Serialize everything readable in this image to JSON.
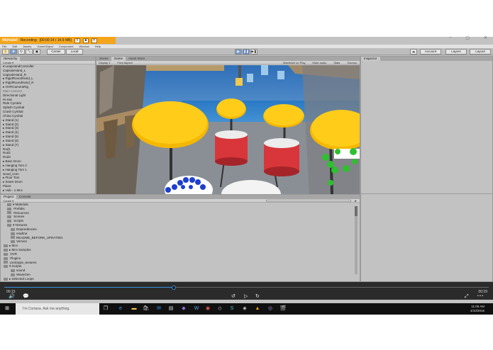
{
  "recorder": {
    "logo": "movavi",
    "status": "Recording",
    "timecode": "[00:00:14 / 14.9 MB]",
    "ctrl_pause": "II",
    "ctrl_stop": "■",
    "ctrl_cancel": "✕"
  },
  "window_controls": {
    "minimize": "–",
    "maximize": "▢",
    "close": "✕"
  },
  "menu": [
    "File",
    "Edit",
    "Assets",
    "GameObject",
    "Component",
    "Window",
    "Help"
  ],
  "toolbar": {
    "pivot": "Center",
    "space": "Local",
    "account": "Account",
    "layers": "Layers",
    "layout": "Layout"
  },
  "hierarchy": {
    "tab": "Hierarchy",
    "create": "Create ▾",
    "items": [
      {
        "label": "▾ LeapHandController",
        "gray": false
      },
      {
        "label": "   CapsuleHand_L",
        "gray": false
      },
      {
        "label": "   CapsuleHand_R",
        "gray": false
      },
      {
        "label": "  ▸ RigidRoundHand_L",
        "gray": false
      },
      {
        "label": "  ▸ RigidRoundHand_R",
        "gray": false
      },
      {
        "label": "▸ OVRCameraRig",
        "gray": false
      },
      {
        "label": "  Main Camera",
        "gray": true
      },
      {
        "label": "  Directional Light",
        "gray": false
      },
      {
        "label": "  Hi-Hat",
        "gray": false
      },
      {
        "label": "  Ride Cymbal",
        "gray": false
      },
      {
        "label": "  Splash Cymbal",
        "gray": false
      },
      {
        "label": "  Crash Cymbal",
        "gray": false
      },
      {
        "label": "  China Cymbal",
        "gray": false
      },
      {
        "label": "▸ Stand (1)",
        "gray": false
      },
      {
        "label": "▸ Stand (2)",
        "gray": false
      },
      {
        "label": "▸ Stand (3)",
        "gray": false
      },
      {
        "label": "▸ Stand (4)",
        "gray": false
      },
      {
        "label": "▸ Stand (5)",
        "gray": false
      },
      {
        "label": "▸ Stand (6)",
        "gray": false
      },
      {
        "label": "▸ Stand (7)",
        "gray": false
      },
      {
        "label": "  Rod1",
        "gray": false
      },
      {
        "label": "  Rod2",
        "gray": false
      },
      {
        "label": "  Rod3",
        "gray": false
      },
      {
        "label": "▸ Bass Drum",
        "gray": false
      },
      {
        "label": "▸ Hanging Tom 2",
        "gray": false
      },
      {
        "label": "▸ Hanging Tom 1",
        "gray": false
      },
      {
        "label": "  wood_scen",
        "gray": false
      },
      {
        "label": "▸ Floor Tom",
        "gray": false
      },
      {
        "label": "▸ Snare Drum",
        "gray": false
      },
      {
        "label": "  Plane",
        "gray": false
      },
      {
        "label": "▸ Hub - 1 Mcs",
        "gray": false
      }
    ]
  },
  "scene_tabs": {
    "scene": "Scene",
    "game": "Game",
    "store": "Asset Store",
    "display": "Display 1",
    "aspect": "Free Aspect",
    "maximize": "Maximize on Play",
    "mute": "Mute audio",
    "stats": "Stats",
    "gizmos": "Gizmos"
  },
  "inspector": {
    "tab": "Inspector"
  },
  "project": {
    "tab_project": "Project",
    "tab_console": "Console",
    "create": "Create ▾",
    "items": [
      {
        "label": "▾ Materials",
        "indent": 1
      },
      {
        "label": "  Prefabs",
        "indent": 1
      },
      {
        "label": "  Resources",
        "indent": 1
      },
      {
        "label": "  Scenes",
        "indent": 1
      },
      {
        "label": "  Scripts",
        "indent": 1
      },
      {
        "label": "▾ Textures",
        "indent": 1
      },
      {
        "label": "Dependencies",
        "indent": 2
      },
      {
        "label": "readme",
        "indent": 2
      },
      {
        "label": "README_BEFORE_UPDATING",
        "indent": 2
      },
      {
        "label": "Version",
        "indent": 2
      },
      {
        "label": "▸ Mcs",
        "indent": 0
      },
      {
        "label": "▸ Mcs Samples",
        "indent": 0
      },
      {
        "label": "  OVR",
        "indent": 0
      },
      {
        "label": "  Plugins",
        "indent": 0
      },
      {
        "label": "  prototype_textures",
        "indent": 0
      },
      {
        "label": "▾ Scripts",
        "indent": 0
      },
      {
        "label": "sound",
        "indent": 2
      },
      {
        "label": "WaveGen",
        "indent": 2
      },
      {
        "label": "▸ Selected Loops",
        "indent": 0
      }
    ]
  },
  "video": {
    "progress": 0.35,
    "elapsed": "00:15",
    "duration": "00:29",
    "more": "• • •"
  },
  "taskbar": {
    "search": "I'm Cortana. Ask me anything.",
    "time": "11:05 AM",
    "date": "4/10/2016"
  },
  "colors": {
    "recorder_bar": "#f4a51c",
    "unity_panel": "#c2c2c2",
    "cymbal_yellow": "#f5b800",
    "drum_red": "#d8363a",
    "sky": "#5da9e0",
    "hand_blue": "#1d3fd0",
    "hand_green": "#2fc02f",
    "taskbar": "#101010",
    "progress": "#3a8fe0"
  }
}
